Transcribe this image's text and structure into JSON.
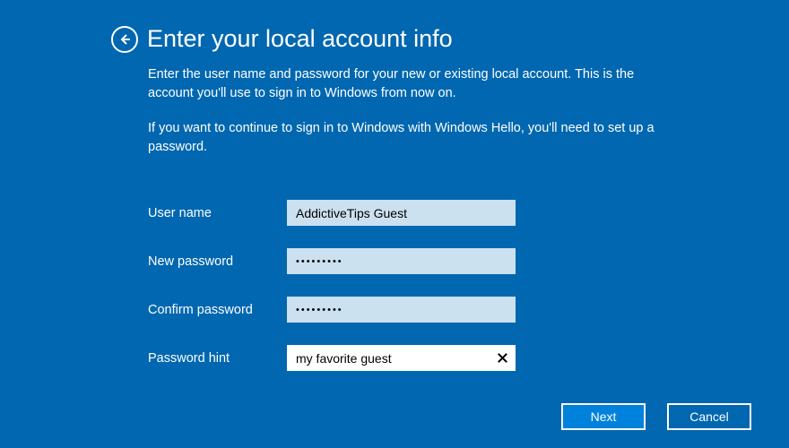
{
  "header": {
    "title": "Enter your local account info"
  },
  "description": {
    "p1": "Enter the user name and password for your new or existing local account. This is the account you'll use to sign in to Windows from now on.",
    "p2": "If you want to continue to sign in to Windows with Windows Hello, you'll need to set up a password."
  },
  "form": {
    "username": {
      "label": "User name",
      "value": "AddictiveTips Guest"
    },
    "newpassword": {
      "label": "New password",
      "value": "•••••••••"
    },
    "confirmpassword": {
      "label": "Confirm password",
      "value": "•••••••••"
    },
    "hint": {
      "label": "Password hint",
      "value": "my favorite guest"
    }
  },
  "buttons": {
    "next": "Next",
    "cancel": "Cancel"
  }
}
